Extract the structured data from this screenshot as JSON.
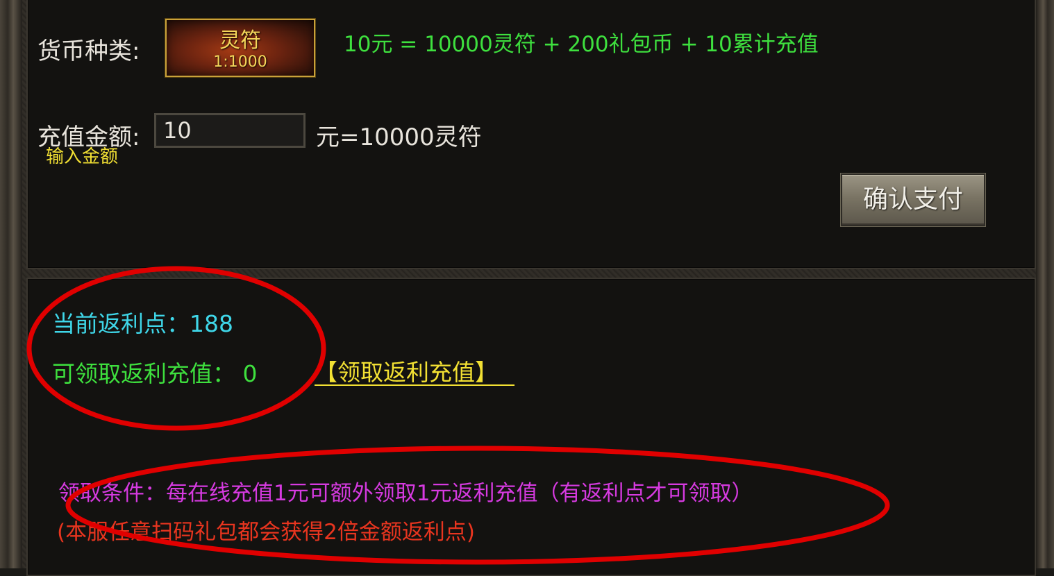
{
  "currency": {
    "label": "货币种类:",
    "tile_name": "灵符",
    "tile_ratio": "1:1000",
    "conversion_note": "10元 = 10000灵符 + 200礼包币 + 10累计充值"
  },
  "recharge": {
    "label": "充值金额:",
    "amount_value": "10",
    "hint": "输入金额",
    "result": "元=10000灵符"
  },
  "confirm_button": "确认支付",
  "rebate": {
    "current_points": "当前返利点：188",
    "claimable": "可领取返利充值：  0",
    "claim_link": "【领取返利充值】"
  },
  "conditions": {
    "line1": "领取条件：每在线充值1元可额外领取1元返利充值（有返利点才可领取）",
    "line2": "(本服任意扫码礼包都会获得2倍金额返利点)"
  },
  "colors": {
    "green": "#3ee03e",
    "yellow": "#f2e033",
    "cyan": "#3fd6e8",
    "magenta": "#d63ae0",
    "red": "#e8351f",
    "annotation_red": "#e00000"
  }
}
